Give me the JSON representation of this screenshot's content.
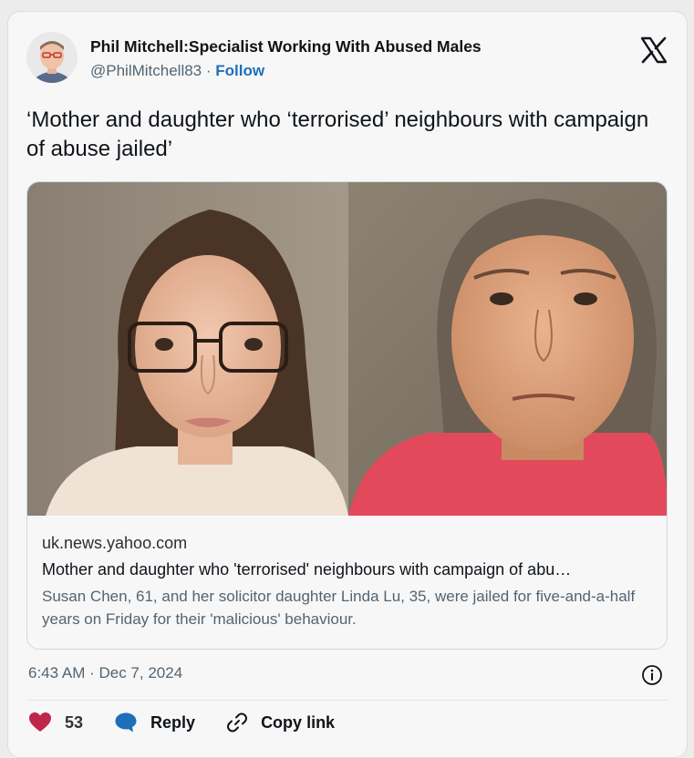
{
  "author": {
    "name": "Phil Mitchell:Specialist Working With Abused Males",
    "handle": "@PhilMitchell83",
    "separator": "·",
    "follow_label": "Follow"
  },
  "tweet": {
    "text": "‘Mother and daughter who ‘terrorised’ neighbours with campaign of abuse jailed’"
  },
  "link_card": {
    "domain": "uk.news.yahoo.com",
    "title": "Mother and daughter who 'terrorised' neighbours with campaign of abu…",
    "description": "Susan Chen, 61, and her solicitor daughter Linda Lu, 35, were jailed for five-and-a-half years on Friday for their 'malicious' behaviour."
  },
  "timestamp": "6:43 AM · Dec 7, 2024",
  "actions": {
    "likes": "53",
    "reply_label": "Reply",
    "copy_label": "Copy link"
  },
  "colors": {
    "like": "#c0264a",
    "reply": "#1d6fb8",
    "follow": "#1d6fb8"
  },
  "icons": [
    "x-logo-icon",
    "info-icon",
    "heart-icon",
    "reply-bubble-icon",
    "link-icon"
  ]
}
